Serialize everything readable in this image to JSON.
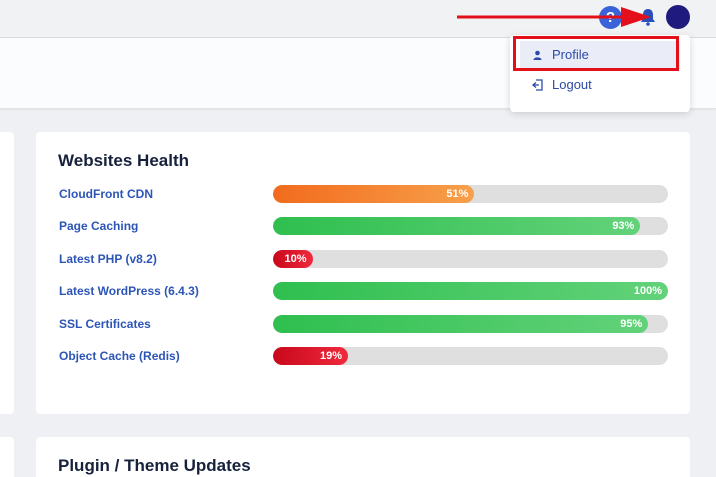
{
  "topbar": {
    "help_symbol": "?",
    "icons": [
      "help-icon",
      "bell-icon",
      "avatar"
    ]
  },
  "user_menu": {
    "items": [
      {
        "label": "Profile",
        "icon": "user-icon"
      },
      {
        "label": "Logout",
        "icon": "logout-icon"
      }
    ]
  },
  "websites_health": {
    "title": "Websites Health",
    "rows": [
      {
        "label": "CloudFront CDN",
        "percent": 51,
        "percent_text": "51%",
        "color_start": "#f26b1d",
        "color_end": "#f7a04b"
      },
      {
        "label": "Page Caching",
        "percent": 93,
        "percent_text": "93%",
        "color_start": "#2fbf4f",
        "color_end": "#63d27a"
      },
      {
        "label": "Latest PHP (v8.2)",
        "percent": 10,
        "percent_text": "10%",
        "color_start": "#c9081c",
        "color_end": "#ef2a3c"
      },
      {
        "label": "Latest WordPress (6.4.3)",
        "percent": 100,
        "percent_text": "100%",
        "color_start": "#2fbf4f",
        "color_end": "#63d27a"
      },
      {
        "label": "SSL Certificates",
        "percent": 95,
        "percent_text": "95%",
        "color_start": "#2fbf4f",
        "color_end": "#63d27a"
      },
      {
        "label": "Object Cache (Redis)",
        "percent": 19,
        "percent_text": "19%",
        "color_start": "#c9081c",
        "color_end": "#ef2a3c"
      }
    ]
  },
  "plugin_updates": {
    "title": "Plugin / Theme Updates"
  },
  "colors": {
    "highlight": "#e3101b",
    "link": "#2c55b6",
    "avatar": "#1f1a7e"
  }
}
